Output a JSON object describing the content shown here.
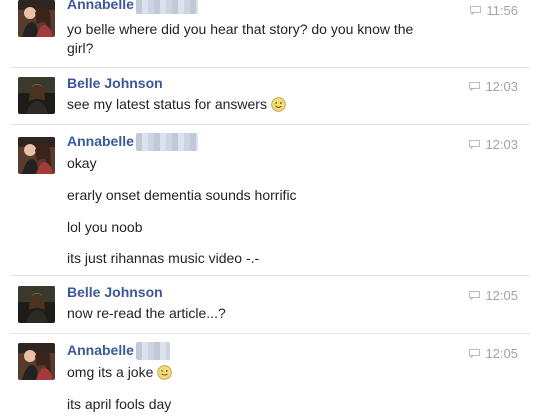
{
  "messages": [
    {
      "sender": "Annabelle",
      "time": "11:56",
      "lines": [
        "yo belle where did you hear that story? do you know the",
        "girl?"
      ]
    },
    {
      "sender": "Belle Johnson",
      "time": "12:03",
      "lines": [
        "see my latest status for answers"
      ]
    },
    {
      "sender": "Annabelle",
      "time": "12:03",
      "lines": [
        "okay",
        "erarly onset dementia sounds horrific",
        "lol you noob",
        "its just rihannas music video -.-"
      ]
    },
    {
      "sender": "Belle Johnson",
      "time": "12:05",
      "lines": [
        "now re-read the article...?"
      ]
    },
    {
      "sender": "Annabelle",
      "time": "12:05",
      "lines": [
        "omg its a joke",
        "its april fools day"
      ]
    }
  ],
  "icons": {
    "timestamp": "chat-bubble-icon",
    "smile": "smile-emoji-icon",
    "tongue": "tongue-emoji-icon"
  },
  "colors": {
    "sender_name": "#3b5998",
    "timestamp": "#a0a4ab",
    "divider": "#e5e5e5"
  }
}
